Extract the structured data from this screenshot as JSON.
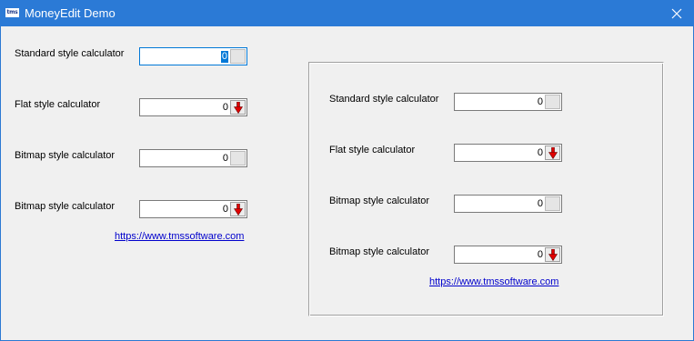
{
  "window": {
    "title": "MoneyEdit Demo",
    "icon_text": "tms",
    "close_icon": "close-icon"
  },
  "left_panel": {
    "rows": [
      {
        "label": "Standard style calculator",
        "value": "0",
        "button": "plain",
        "focused": true
      },
      {
        "label": "Flat style calculator",
        "value": "0",
        "button": "down-arrow",
        "focused": false
      },
      {
        "label": "Bitmap style calculator",
        "value": "0",
        "button": "plain",
        "focused": false
      },
      {
        "label": "Bitmap style calculator",
        "value": "0",
        "button": "down-arrow",
        "focused": false
      }
    ],
    "link": "https://www.tmssoftware.com"
  },
  "right_panel": {
    "rows": [
      {
        "label": "Standard style calculator",
        "value": "0",
        "button": "plain"
      },
      {
        "label": "Flat style calculator",
        "value": "0",
        "button": "down-arrow"
      },
      {
        "label": "Bitmap style calculator",
        "value": "0",
        "button": "plain"
      },
      {
        "label": "Bitmap style calculator",
        "value": "0",
        "button": "down-arrow"
      }
    ],
    "link": "https://www.tmssoftware.com"
  },
  "colors": {
    "titlebar": "#2b7ad6",
    "window_bg": "#f0f0f0",
    "link": "#0000cc",
    "arrow_red": "#e00000",
    "focus_border": "#0078d7"
  }
}
